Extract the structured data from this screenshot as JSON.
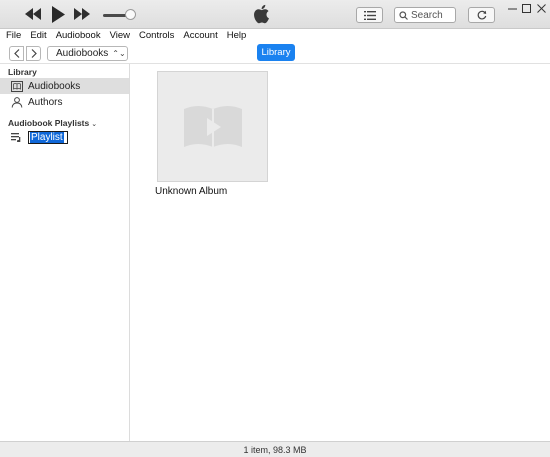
{
  "player": {
    "rewind_icon": "rewind-icon",
    "play_icon": "play-icon",
    "fast_forward_icon": "fast-forward-icon",
    "volume_level": 0.85,
    "logo": "apple-logo",
    "search_placeholder": "Search"
  },
  "menu": {
    "items": [
      "File",
      "Edit",
      "Audiobook",
      "View",
      "Controls",
      "Account",
      "Help"
    ]
  },
  "nav": {
    "media_kind": "Audiobooks",
    "library_label": "Library",
    "accent_color": "#1a82f0"
  },
  "sidebar": {
    "library_heading": "Library",
    "items": [
      {
        "label": "Audiobooks",
        "icon": "audiobook-icon",
        "selected": true
      },
      {
        "label": "Authors",
        "icon": "author-icon",
        "selected": false
      }
    ],
    "playlists_heading": "Audiobook Playlists",
    "playlist_edit_value": "Playlist"
  },
  "main": {
    "albums": [
      {
        "title": "Unknown Album",
        "art_icon": "audiobook-placeholder-icon"
      }
    ]
  },
  "status": {
    "summary": "1 item, 98.3 MB"
  }
}
